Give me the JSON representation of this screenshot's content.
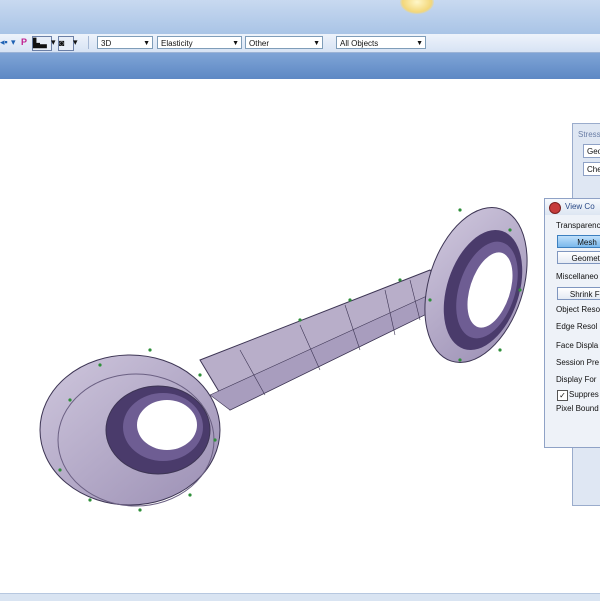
{
  "toolbar": {
    "combos": [
      {
        "name": "view-mode-combo",
        "value": "3D"
      },
      {
        "name": "analysis-type-combo",
        "value": "Elasticity"
      },
      {
        "name": "other-combo",
        "value": "Other"
      },
      {
        "name": "object-filter-combo",
        "value": "All Objects"
      }
    ],
    "p_label": "P"
  },
  "stress_panel": {
    "title": "Stress",
    "btn1": "Geo",
    "btn2": "Che"
  },
  "dialog": {
    "title": "View Co",
    "transparency_label": "Transparenc",
    "mesh_button": "Mesh",
    "geometry_button": "Geometr",
    "misc_label": "Miscellaneo",
    "shrink_button": "Shrink Fe",
    "object_res_label": "Object Reso",
    "edge_res_label": "Edge Resol",
    "face_display_label": "Face Displa",
    "session_pref_label": "Session Pre",
    "display_format_label": "Display For",
    "suppress_label": "Suppres",
    "suppress_checked": "✓",
    "pixel_bound_label": "Pixel Bound"
  },
  "colors": {
    "part_fill": "#b8aec9",
    "part_dark": "#4a3b6b",
    "mesh_line": "#3d3554",
    "node": "#2f8f3a"
  }
}
